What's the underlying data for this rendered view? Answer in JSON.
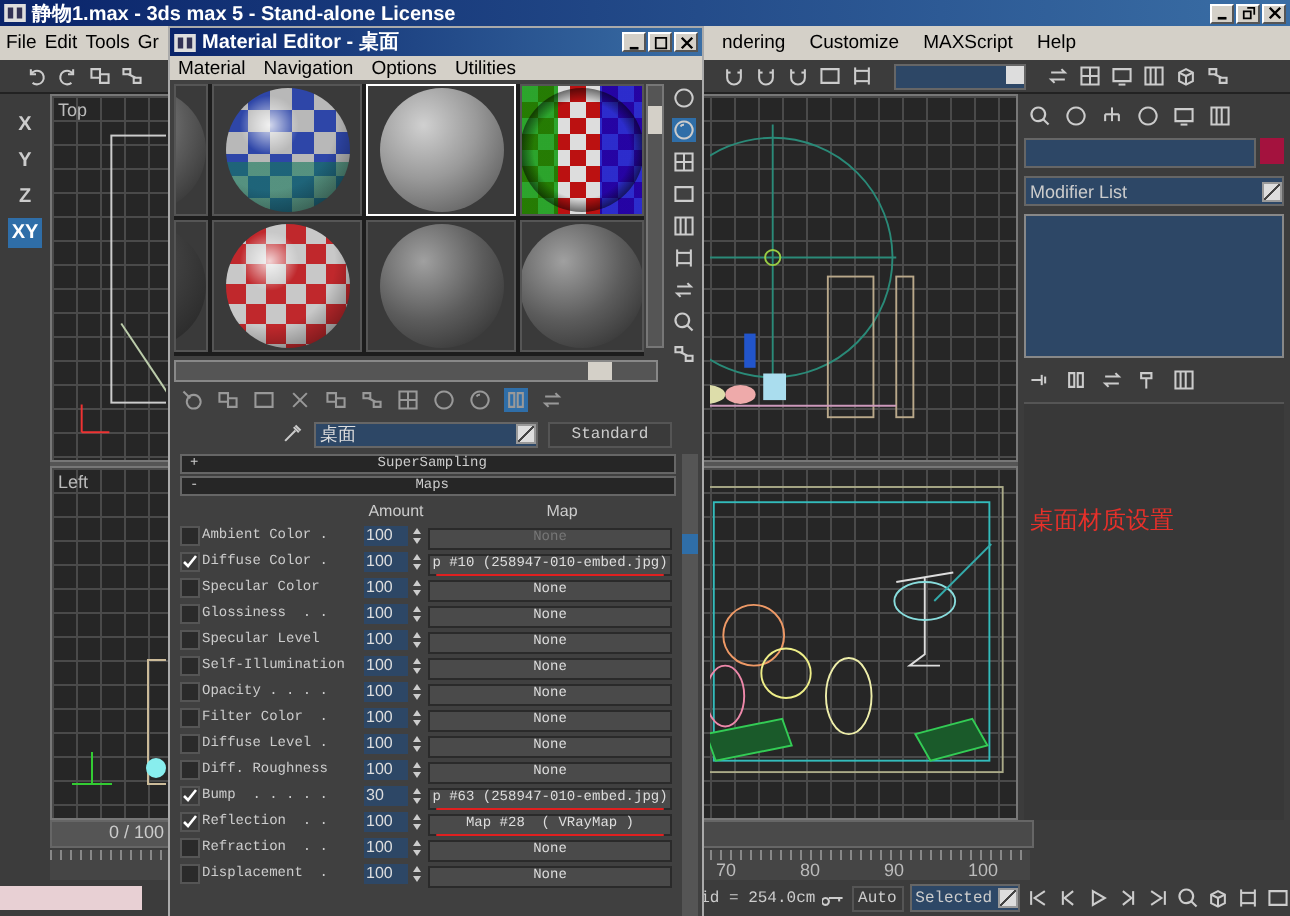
{
  "main_window": {
    "title": "静物1.max - 3ds max 5 - Stand-alone License"
  },
  "menu_bar": {
    "items": [
      {
        "label": "File"
      },
      {
        "label": "Edit"
      },
      {
        "label": "Tools"
      },
      {
        "label": "Gr"
      }
    ],
    "items_right": [
      {
        "label": "ndering"
      },
      {
        "label": "Customize"
      },
      {
        "label": "MAXScript"
      },
      {
        "label": "Help"
      }
    ]
  },
  "axis_constraints": [
    {
      "label": "X",
      "selected": false
    },
    {
      "label": "Y",
      "selected": false
    },
    {
      "label": "Z",
      "selected": false
    },
    {
      "label": "XY",
      "selected": true
    }
  ],
  "viewports": [
    {
      "label": "Top",
      "kind": "top"
    },
    {
      "kind": "front"
    },
    {
      "label": "Left",
      "kind": "left"
    },
    {
      "kind": "perspective"
    }
  ],
  "command_panel": {
    "modifier_list": "Modifier List",
    "note": "桌面材质设置"
  },
  "timeline": {
    "frame": "0 / 100",
    "ticks": [
      "70",
      "80",
      "90",
      "100"
    ]
  },
  "status_bar": {
    "grid": "id = 254.0cm",
    "key_mode": "Auto",
    "selection": "Selected"
  },
  "material_editor": {
    "title": "Material Editor - 桌面",
    "menu": [
      {
        "label": "Material"
      },
      {
        "label": "Navigation"
      },
      {
        "label": "Options"
      },
      {
        "label": "Utilities"
      }
    ],
    "slots": [
      {
        "kind": "partial",
        "selected": false
      },
      {
        "kind": "checker-blue",
        "selected": false
      },
      {
        "kind": "marble",
        "selected": true
      },
      {
        "kind": "multi-checker",
        "selected": false
      },
      {
        "kind": "partial-dark",
        "selected": false
      },
      {
        "kind": "checker-red",
        "selected": false
      },
      {
        "kind": "plain",
        "selected": false
      },
      {
        "kind": "plain",
        "selected": false
      }
    ],
    "side_tools": [
      {
        "kind": "circle",
        "selected": false
      },
      {
        "kind": "sphere",
        "selected": true
      },
      {
        "kind": "checker",
        "selected": false
      },
      {
        "kind": "square",
        "selected": false
      },
      {
        "kind": "stripes",
        "selected": false
      },
      {
        "kind": "frame",
        "selected": false
      },
      {
        "kind": "swap",
        "selected": false
      },
      {
        "kind": "magnify",
        "selected": false
      },
      {
        "kind": "nodes",
        "selected": false
      }
    ],
    "bottom_tools": [
      {
        "kind": "arrow-sphere",
        "selected": false
      },
      {
        "kind": "link",
        "selected": false
      },
      {
        "kind": "square",
        "selected": false
      },
      {
        "kind": "x",
        "selected": false
      },
      {
        "kind": "link",
        "selected": false
      },
      {
        "kind": "nodes",
        "selected": false
      },
      {
        "kind": "checker",
        "selected": false
      },
      {
        "kind": "circle",
        "selected": false
      },
      {
        "kind": "sphere",
        "selected": false
      },
      {
        "kind": "pause",
        "selected": true
      },
      {
        "kind": "swap",
        "selected": false
      }
    ],
    "material_name": "桌面",
    "material_type": "Standard",
    "rollouts": [
      {
        "toggle": "+",
        "label": "SuperSampling"
      },
      {
        "toggle": "-",
        "label": "Maps"
      }
    ],
    "maps": {
      "columns": [
        "Amount",
        "Map"
      ],
      "rows": [
        {
          "name": "Ambient Color .",
          "checked": false,
          "amount": "100",
          "map": "None",
          "disabled": true,
          "annotated": false
        },
        {
          "name": "Diffuse Color .",
          "checked": true,
          "amount": "100",
          "map": "p #10 (258947-010-embed.jpg)",
          "disabled": false,
          "annotated": true
        },
        {
          "name": "Specular Color",
          "checked": false,
          "amount": "100",
          "map": "None",
          "disabled": false,
          "annotated": false
        },
        {
          "name": "Glossiness  . .",
          "checked": false,
          "amount": "100",
          "map": "None",
          "disabled": false,
          "annotated": false
        },
        {
          "name": "Specular Level",
          "checked": false,
          "amount": "100",
          "map": "None",
          "disabled": false,
          "annotated": false
        },
        {
          "name": "Self-Illumination",
          "checked": false,
          "amount": "100",
          "map": "None",
          "disabled": false,
          "annotated": false
        },
        {
          "name": "Opacity . . . .",
          "checked": false,
          "amount": "100",
          "map": "None",
          "disabled": false,
          "annotated": false
        },
        {
          "name": "Filter Color  .",
          "checked": false,
          "amount": "100",
          "map": "None",
          "disabled": false,
          "annotated": false
        },
        {
          "name": "Diffuse Level .",
          "checked": false,
          "amount": "100",
          "map": "None",
          "disabled": false,
          "annotated": false
        },
        {
          "name": "Diff. Roughness",
          "checked": false,
          "amount": "100",
          "map": "None",
          "disabled": false,
          "annotated": false
        },
        {
          "name": "Bump  . . . . .",
          "checked": true,
          "amount": "30",
          "map": "p #63 (258947-010-embed.jpg)",
          "disabled": false,
          "annotated": true
        },
        {
          "name": "Reflection  . .",
          "checked": true,
          "amount": "100",
          "map": "Map #28  ( VRayMap )",
          "disabled": false,
          "annotated": true
        },
        {
          "name": "Refraction  . .",
          "checked": false,
          "amount": "100",
          "map": "None",
          "disabled": false,
          "annotated": false
        },
        {
          "name": "Displacement  .",
          "checked": false,
          "amount": "100",
          "map": "None",
          "disabled": false,
          "annotated": false
        }
      ]
    }
  }
}
